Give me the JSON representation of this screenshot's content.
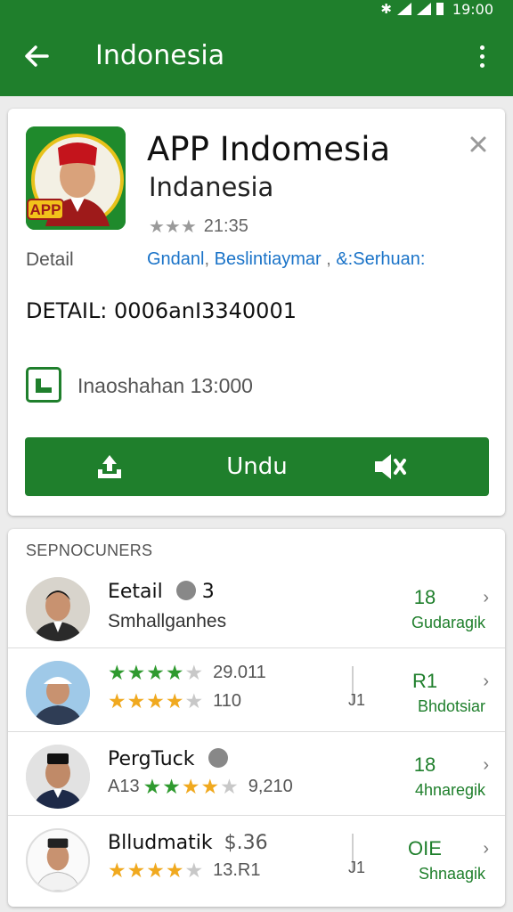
{
  "status_bar": {
    "time": "19:00",
    "icons": [
      "bluetooth-icon",
      "signal-icon",
      "signal-icon",
      "battery-icon"
    ]
  },
  "app_bar": {
    "title": "Indonesia",
    "back_icon": "arrow-back-icon",
    "menu_icon": "more-vert-icon"
  },
  "app_card": {
    "icon_text": "APP",
    "name": "APP Indomesia",
    "subtitle": "Indanesia",
    "rating": "21:35",
    "detail_label": "Detail",
    "links": [
      "Gndanl",
      "Beslintiaymar",
      "&:Serhuan:"
    ],
    "detail_line": "DETAIL: 0006anI3340001",
    "info_text": "Inaoshahan 13:000",
    "install_label": "Undu"
  },
  "list": {
    "header": "SEPNOCUNERS",
    "items": [
      {
        "name": "Eetail",
        "name_suffix": "3",
        "sub": "Smhallganhes",
        "number": "18",
        "caption": "Gudaragik"
      },
      {
        "rating_top": "29.011",
        "rating_bottom": "110",
        "divider_text": "J1",
        "number": "R1",
        "caption": "Bhdotsiar"
      },
      {
        "name": "PergTuck",
        "rating_prefix": "A13",
        "rating_value": "9,210",
        "number": "18",
        "caption": "4hnaregik"
      },
      {
        "name": "Blludmatik",
        "name_suffix": "$.36",
        "rating_value": "13.R1",
        "divider_text": "J1",
        "number": "OIE",
        "caption": "Shnaagik"
      }
    ]
  },
  "colors": {
    "brand_green": "#1f7f2c",
    "link_blue": "#1a73c8",
    "star_green": "#2f9a2f",
    "star_orange": "#f0a91f"
  }
}
